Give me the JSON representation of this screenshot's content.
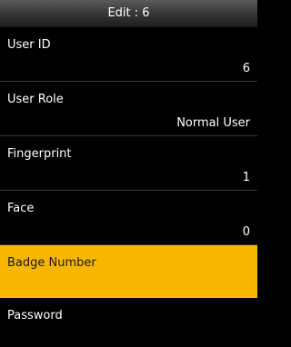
{
  "header": {
    "title": "Edit : 6"
  },
  "fields": [
    {
      "label": "User ID",
      "value": "6"
    },
    {
      "label": "User Role",
      "value": "Normal User"
    },
    {
      "label": "Fingerprint",
      "value": "1"
    },
    {
      "label": "Face",
      "value": "0"
    },
    {
      "label": "Badge Number",
      "value": ""
    },
    {
      "label": "Password",
      "value": ""
    }
  ],
  "selected_field": "Badge Number",
  "colors": {
    "background": "#000000",
    "highlight": "#f7b700",
    "divider": "#3a3a3a",
    "text": "#ffffff"
  }
}
